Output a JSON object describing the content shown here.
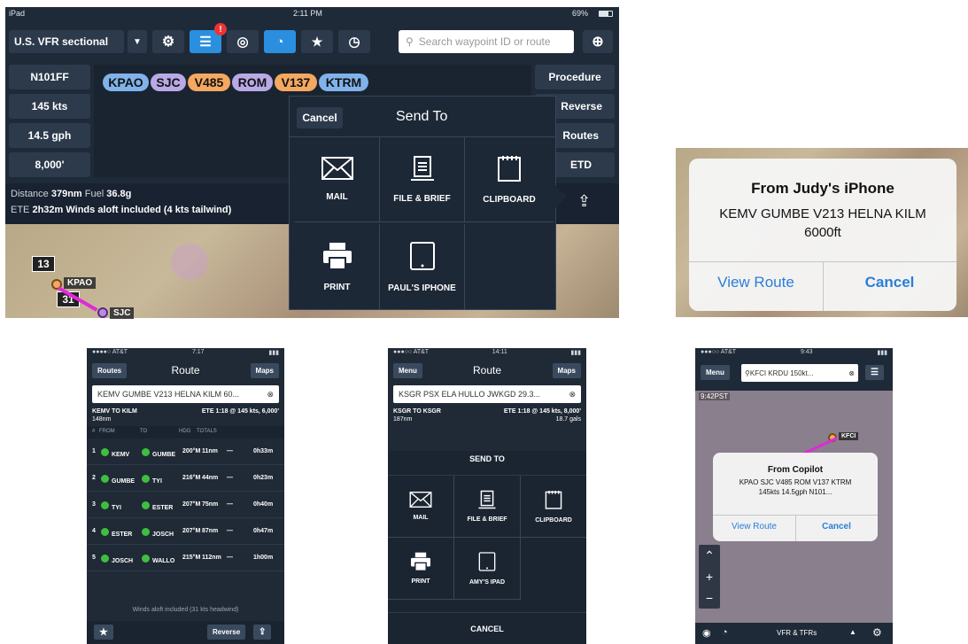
{
  "ipad": {
    "status": {
      "device": "iPad",
      "time": "2:11 PM",
      "battery": "69%"
    },
    "toolbar": {
      "chart_select": "U.S. VFR sectional",
      "search_placeholder": "Search waypoint ID or route"
    },
    "left_fields": [
      "N101FF",
      "145 kts",
      "14.5 gph",
      "8,000'"
    ],
    "route_pills": [
      {
        "label": "KPAO",
        "color": "#7fb3ea"
      },
      {
        "label": "SJC",
        "color": "#b9a9e6"
      },
      {
        "label": "V485",
        "color": "#f4a860"
      },
      {
        "label": "ROM",
        "color": "#b9a9e6"
      },
      {
        "label": "V137",
        "color": "#f4a860"
      },
      {
        "label": "KTRM",
        "color": "#7fb3ea"
      }
    ],
    "right_buttons": [
      "Procedure",
      "Reverse",
      "Routes",
      "ETD"
    ],
    "summary": {
      "line1_a": "Distance ",
      "line1_b": "379nm",
      "line1_c": "  Fuel ",
      "line1_d": "36.8g",
      "line2_a": "ETE ",
      "line2_b": "2h32m",
      "line2_c": "  Winds aloft included (4 kts tailwind)"
    },
    "map_labels": {
      "num1": "13",
      "airport1": "KPAO",
      "num2": "31",
      "airport2": "SJC"
    },
    "sendto": {
      "cancel": "Cancel",
      "title": "Send To",
      "items": [
        "MAIL",
        "FILE & BRIEF",
        "CLIPBOARD",
        "PRINT",
        "PAUL'S IPHONE"
      ]
    },
    "badge": "!"
  },
  "alert_large": {
    "title": "From Judy's iPhone",
    "body1": "KEMV GUMBE V213 HELNA KILM",
    "body2": "6000ft",
    "left": "View Route",
    "right": "Cancel"
  },
  "phone1": {
    "status": {
      "carrier": "●●●●○ AT&T",
      "time": "7:17"
    },
    "nav": {
      "back": "Routes",
      "title": "Route",
      "right": "Maps"
    },
    "search": "KEMV GUMBE V213 HELNA KILM 60...",
    "info": {
      "from_to": "KEMV TO KILM",
      "ete": "ETE 1:18 @ 145 kts, 6,000'",
      "dist": "148nm"
    },
    "cols": [
      "#",
      "FROM",
      "TO",
      "HDG",
      "TOTALS"
    ],
    "rows": [
      {
        "n": "1",
        "from": "KEMV",
        "to": "GUMBE",
        "hdg": "200°M",
        "dist": "11nm",
        "dash": "—",
        "time": "0h33m"
      },
      {
        "n": "2",
        "from": "GUMBE",
        "to": "TYI",
        "hdg": "216°M",
        "dist": "44nm",
        "dash": "—",
        "time": "0h23m"
      },
      {
        "n": "3",
        "from": "TYI",
        "to": "ESTER",
        "hdg": "207°M",
        "dist": "75nm",
        "dash": "—",
        "time": "0h40m"
      },
      {
        "n": "4",
        "from": "ESTER",
        "to": "JOSCH",
        "hdg": "207°M",
        "dist": "87nm",
        "dash": "—",
        "time": "0h47m"
      },
      {
        "n": "5",
        "from": "JOSCH",
        "to": "WALLO",
        "hdg": "215°M",
        "dist": "112nm",
        "dash": "—",
        "time": "1h00m"
      }
    ],
    "winds": "Winds aloft included (31 kts headwind)",
    "reverse": "Reverse"
  },
  "phone2": {
    "status": {
      "carrier": "●●●○○ AT&T",
      "time": "14:11"
    },
    "nav": {
      "back": "Menu",
      "title": "Route",
      "right": "Maps"
    },
    "search": "KSGR PSX ELA HULLO JWKGD 29.3...",
    "info": {
      "from_to": "KSGR TO KSGR",
      "ete": "ETE 1:18 @ 145 kts, 8,000'",
      "dist": "187nm",
      "fuel": "18.7 gals"
    },
    "sendto": "SEND TO",
    "items": [
      "MAIL",
      "FILE & BRIEF",
      "CLIPBOARD",
      "PRINT",
      "AMY'S IPAD"
    ],
    "cancel": "CANCEL"
  },
  "phone3": {
    "status": {
      "carrier": "●●●○○ AT&T",
      "time": "9:43"
    },
    "menu": "Menu",
    "search": "KFCI KRDU 150kt...",
    "map_time": "9:42PST",
    "airport": "KFCI",
    "alert": {
      "title": "From Copilot",
      "body1": "KPAO SJC V485 ROM V137 KTRM",
      "body2": "145kts 14.5gph N101...",
      "left": "View Route",
      "right": "Cancel"
    },
    "bottom": "VFR & TFRs"
  }
}
